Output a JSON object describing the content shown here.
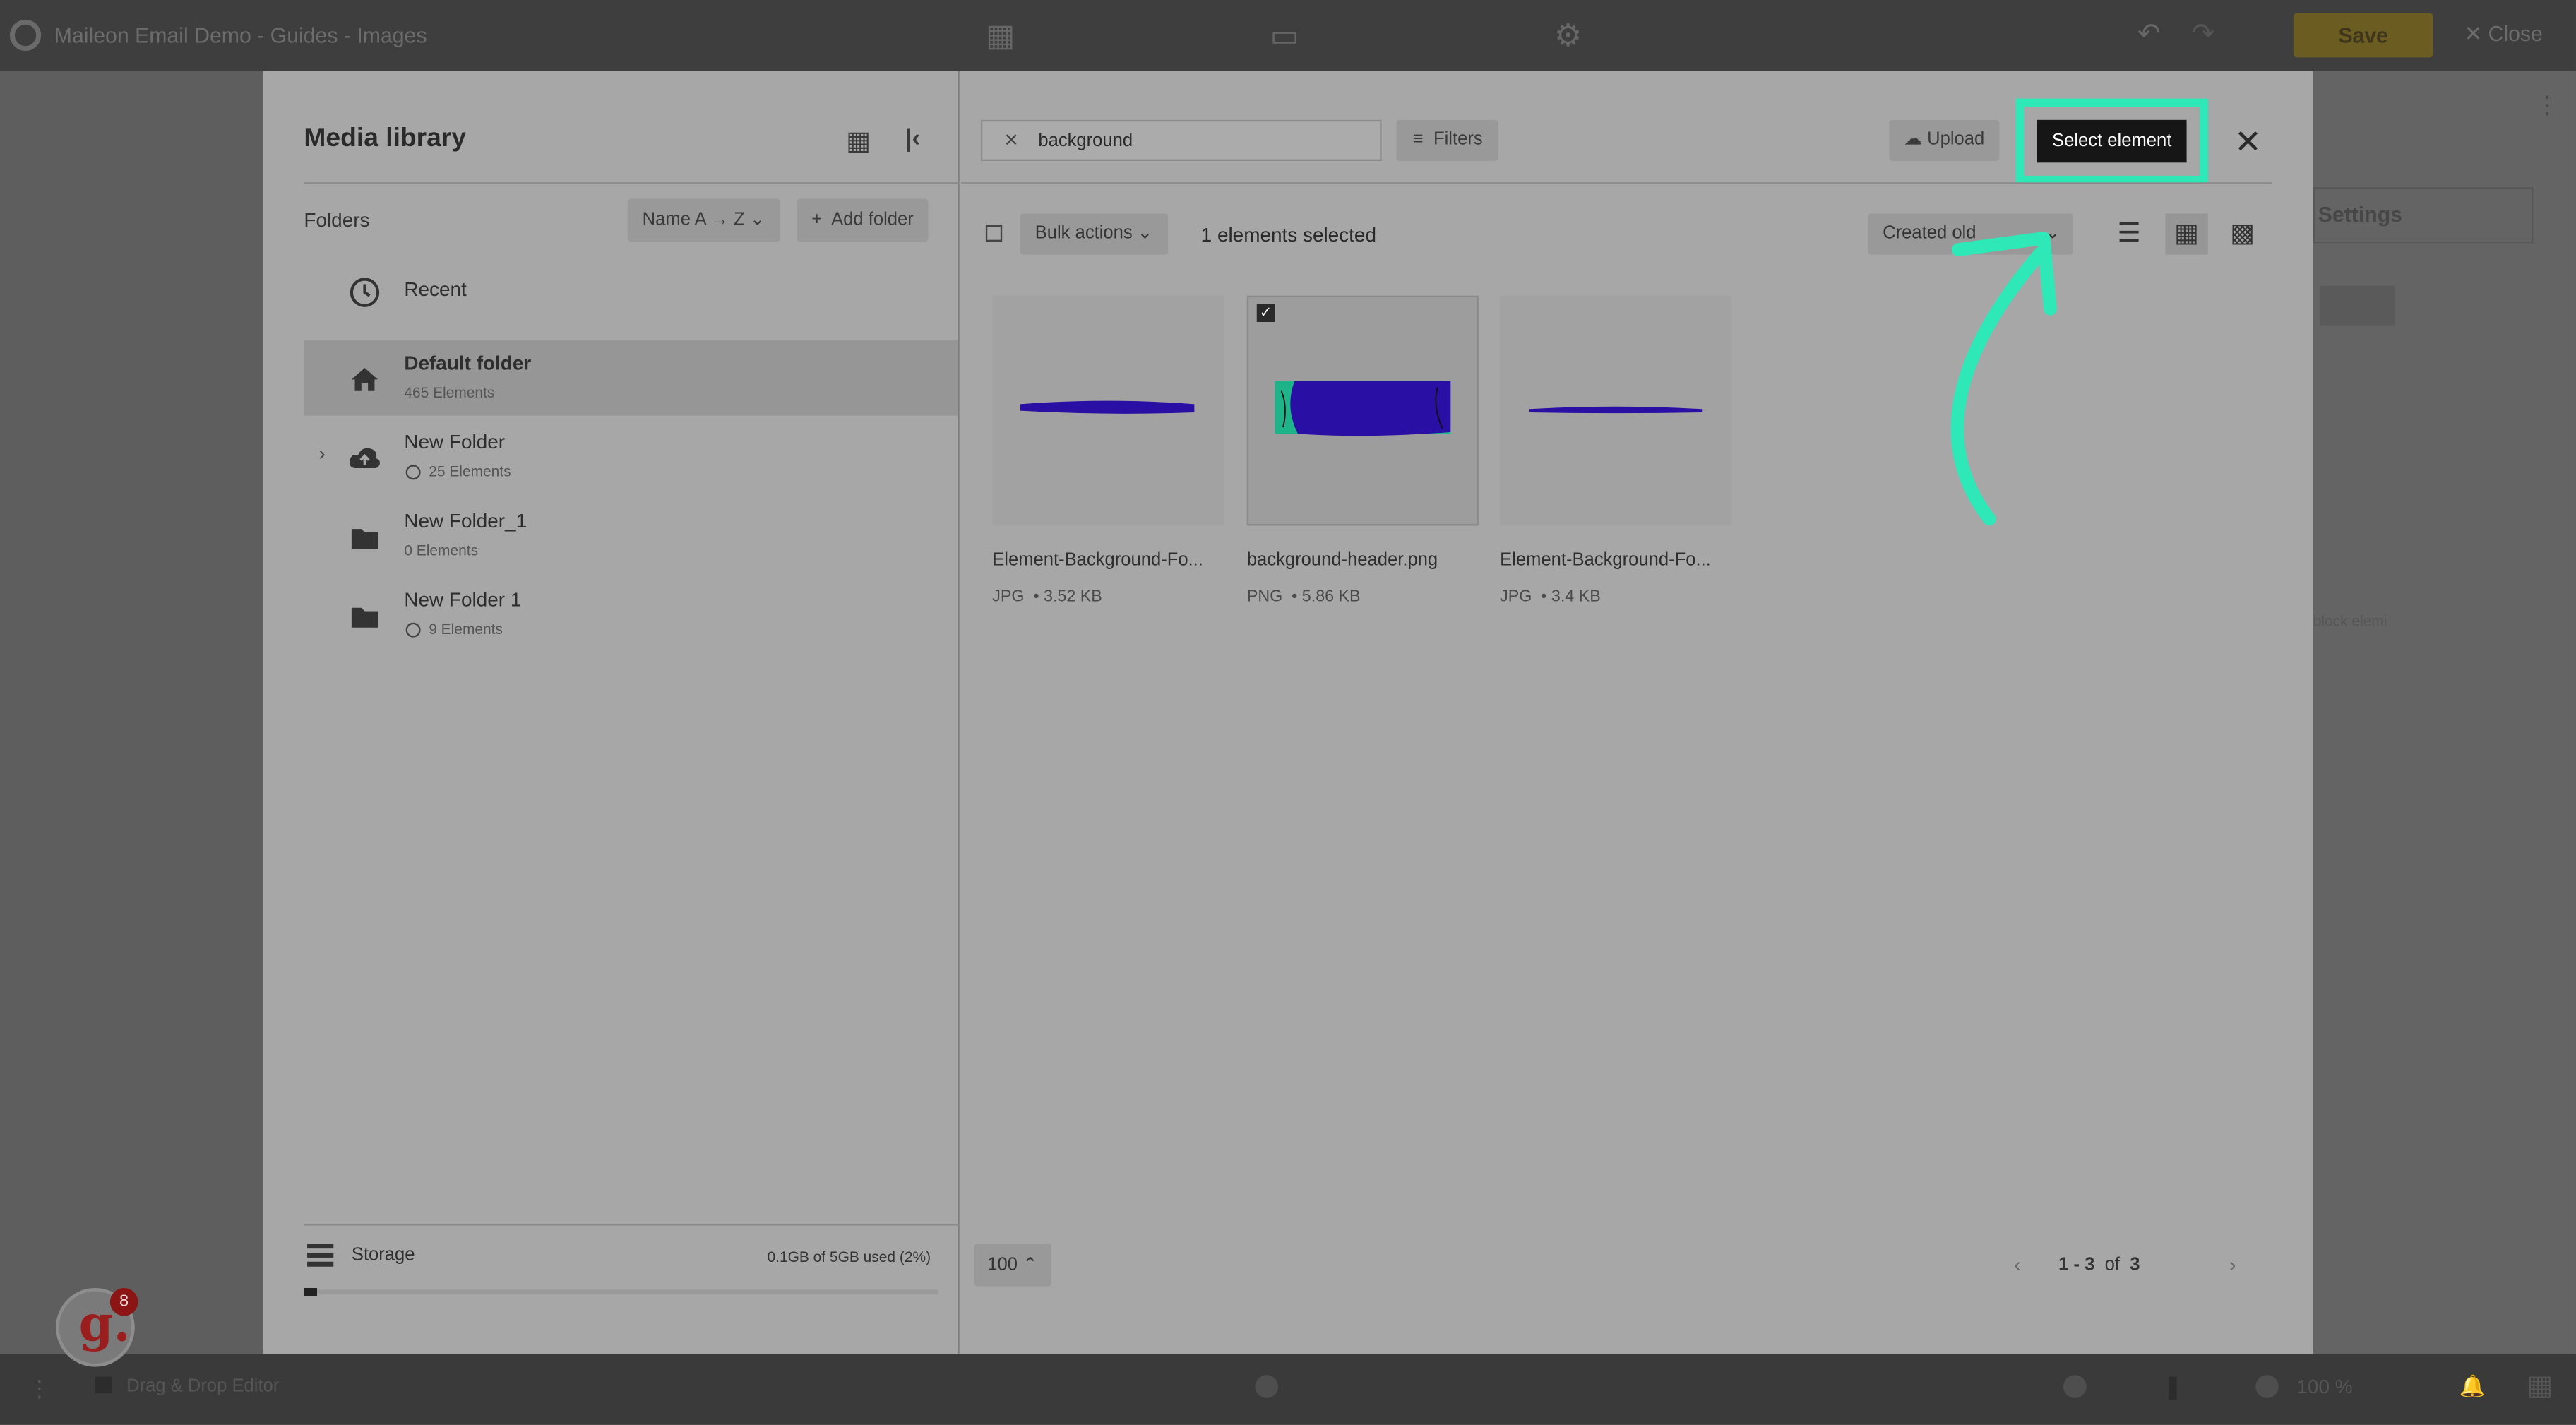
{
  "app": {
    "title": "Maileon Email Demo - Guides - Images",
    "save_label": "Save",
    "close_label": "Close",
    "settings_label": "Settings",
    "block_hint": "block elemi",
    "editor_mode": "Drag & Drop Editor",
    "zoom": "100 %"
  },
  "media_library": {
    "title": "Media library",
    "folders_label": "Folders",
    "sort_folders": "Name A → Z",
    "add_folder": "Add folder",
    "folders": [
      {
        "name": "Recent",
        "count": ""
      },
      {
        "name": "Default folder",
        "count": "465 Elements"
      },
      {
        "name": "New Folder",
        "count": "25 Elements"
      },
      {
        "name": "New Folder_1",
        "count": "0 Elements"
      },
      {
        "name": "New Folder 1",
        "count": "9 Elements"
      }
    ],
    "storage": {
      "label": "Storage",
      "used": "0.1GB of 5GB used (2%)",
      "fraction": 0.02
    }
  },
  "toolbar": {
    "search_value": "background",
    "filters": "Filters",
    "upload": "Upload",
    "select_element": "Select element",
    "bulk_actions": "Bulk actions",
    "selected_count": "1 elements selected",
    "sort": "Created old"
  },
  "items": [
    {
      "name": "Element-Background-Fo...",
      "type": "JPG",
      "size": "3.52 KB",
      "selected": false
    },
    {
      "name": "background-header.png",
      "type": "PNG",
      "size": "5.86 KB",
      "selected": true
    },
    {
      "name": "Element-Background-Fo...",
      "type": "JPG",
      "size": "3.4 KB",
      "selected": false
    }
  ],
  "pagination": {
    "per_page": "100",
    "range": "1 - 3",
    "of_label": "of",
    "total": "3"
  },
  "badge": {
    "count": "8"
  },
  "colors": {
    "highlight": "#2ee8b8",
    "image_blue": "#2a0fa5",
    "image_teal": "#1fb38a"
  }
}
